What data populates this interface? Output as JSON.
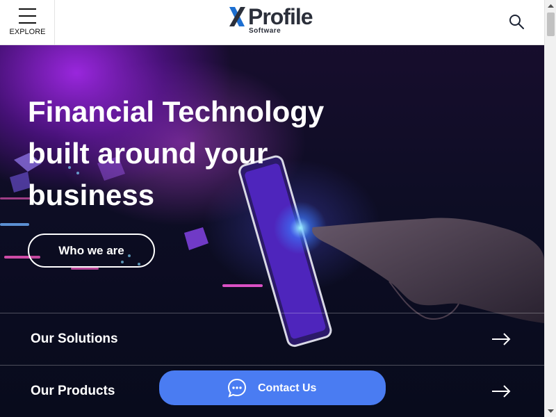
{
  "header": {
    "explore_label": "EXPLORE",
    "logo_word": "Profile",
    "logo_sub": "Software"
  },
  "hero": {
    "headline_lines": [
      "Financial Technology",
      "built around your",
      "business"
    ],
    "cta_label": "Who we are"
  },
  "nav_rows": [
    {
      "label": "Our Solutions"
    },
    {
      "label": "Our Products"
    }
  ],
  "contact": {
    "label": "Contact Us"
  },
  "colors": {
    "accent": "#4a7cf2",
    "hero_dark": "#0d0d24",
    "hero_purple": "#a028e6",
    "logo_blue": "#1d6fd1",
    "logo_dark": "#2b2f3a"
  },
  "icons": [
    "hamburger-icon",
    "search-icon",
    "arrow-right-icon",
    "chat-icon",
    "scroll-up-icon",
    "scroll-down-icon"
  ]
}
